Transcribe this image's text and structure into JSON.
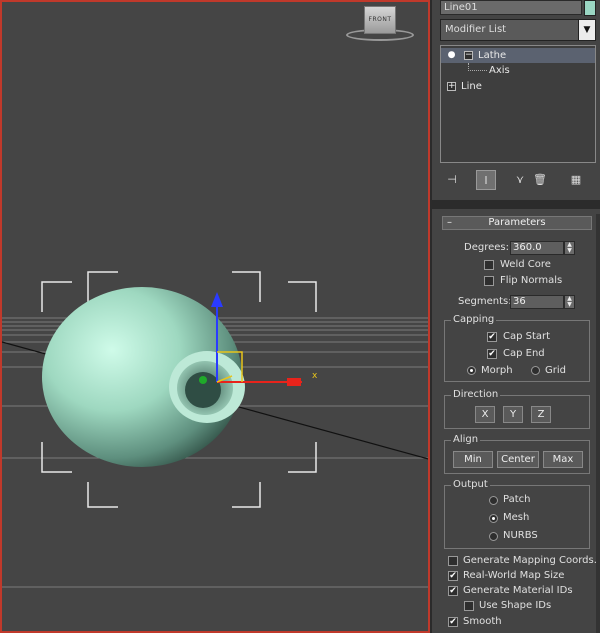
{
  "viewport": {
    "viewcube_label": "FRONT",
    "axis_x_label": "x"
  },
  "panel": {
    "object_name": "Line01",
    "object_color": "#9ad6c3",
    "modifier_list_label": "Modifier List",
    "modifier_list_arrow": "▼",
    "stack": {
      "items": [
        {
          "label": "Lathe",
          "selected": true
        },
        {
          "label": "Axis",
          "selected": false
        },
        {
          "label": "Line",
          "selected": false
        }
      ]
    },
    "toolbar": {
      "pin": "⊣",
      "show_end": "I",
      "unique": "⋎",
      "remove": "🗑",
      "configure": "▦"
    },
    "parameters": {
      "title": "Parameters",
      "collapse": "–",
      "degrees_label": "Degrees:",
      "degrees_value": "360.0",
      "weld_core_label": "Weld Core",
      "weld_core_checked": false,
      "flip_normals_label": "Flip Normals",
      "flip_normals_checked": false,
      "segments_label": "Segments:",
      "segments_value": "36",
      "capping": {
        "title": "Capping",
        "cap_start_label": "Cap Start",
        "cap_start_checked": true,
        "cap_end_label": "Cap End",
        "cap_end_checked": true,
        "morph_label": "Morph",
        "grid_label": "Grid",
        "selected": "Morph"
      },
      "direction": {
        "title": "Direction",
        "x": "X",
        "y": "Y",
        "z": "Z"
      },
      "align": {
        "title": "Align",
        "min": "Min",
        "center": "Center",
        "max": "Max"
      },
      "output": {
        "title": "Output",
        "patch": "Patch",
        "mesh": "Mesh",
        "nurbs": "NURBS",
        "selected": "Mesh"
      },
      "gen_mapping_label": "Generate Mapping Coords.",
      "gen_mapping_checked": false,
      "real_world_label": "Real-World Map Size",
      "real_world_checked": true,
      "gen_material_label": "Generate Material IDs",
      "gen_material_checked": true,
      "use_shape_label": "Use Shape IDs",
      "use_shape_checked": false,
      "smooth_label": "Smooth",
      "smooth_checked": true
    },
    "check_mark": "✔"
  }
}
